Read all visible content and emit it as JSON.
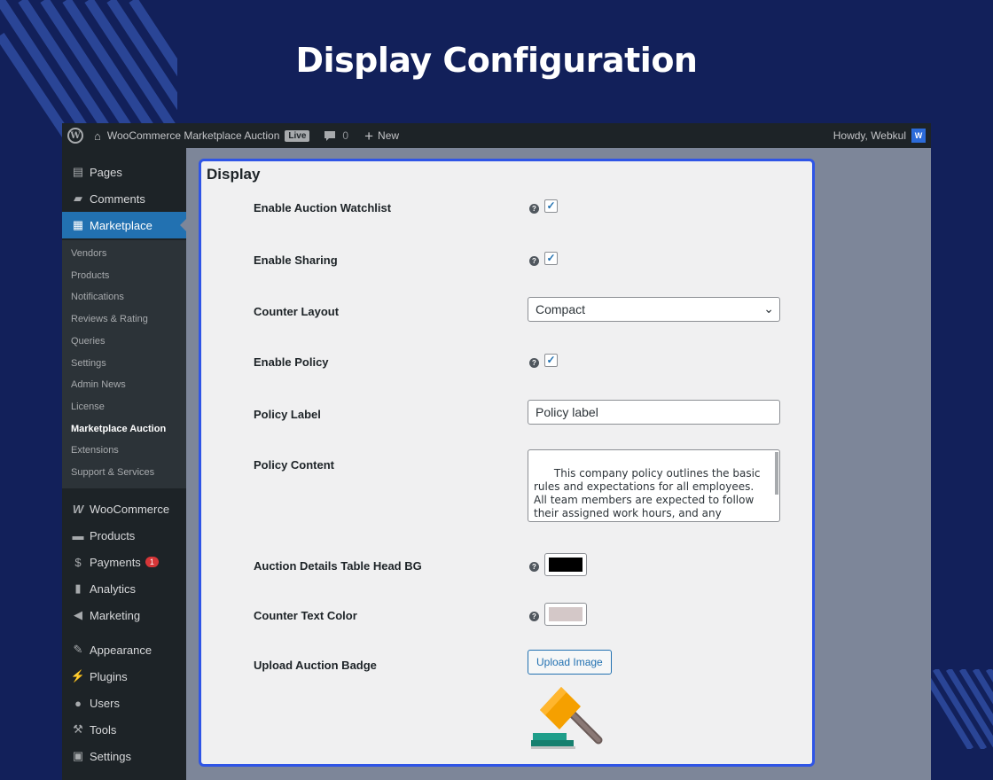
{
  "hero": {
    "title": "Display Configuration"
  },
  "colors": {
    "background": "#12205a",
    "accent": "#2f55e6",
    "wp_blue": "#2271b1",
    "admin_bar": "#1d2327",
    "table_head_bg": "#000000",
    "counter_text": "#d4c8c8"
  },
  "adminbar": {
    "wp_icon": "wordpress-icon",
    "site_icon": "home-icon",
    "site_name": "WooCommerce Marketplace Auction",
    "live_badge": "Live",
    "comments_icon": "comment-bubble-icon",
    "comments_count": "0",
    "new_icon": "plus-icon",
    "new_label": "New",
    "howdy": "Howdy, Webkul"
  },
  "sidebar": {
    "top_items": [
      {
        "label": "Pages",
        "icon": "pages-icon"
      },
      {
        "label": "Comments",
        "icon": "comment-icon"
      },
      {
        "label": "Marketplace",
        "icon": "store-icon"
      }
    ],
    "submenu": [
      "Vendors",
      "Products",
      "Notifications",
      "Reviews & Rating",
      "Queries",
      "Settings",
      "Admin News",
      "License",
      "Marketplace Auction",
      "Extensions",
      "Support & Services"
    ],
    "bottom_items": [
      {
        "label": "WooCommerce",
        "icon": "woo-icon"
      },
      {
        "label": "Products",
        "icon": "archive-icon"
      },
      {
        "label": "Payments",
        "icon": "dollar-icon",
        "badge": "1"
      },
      {
        "label": "Analytics",
        "icon": "chart-bars-icon"
      },
      {
        "label": "Marketing",
        "icon": "megaphone-icon"
      },
      {
        "label": "Appearance",
        "icon": "brush-icon"
      },
      {
        "label": "Plugins",
        "icon": "plug-icon"
      },
      {
        "label": "Users",
        "icon": "user-icon"
      },
      {
        "label": "Tools",
        "icon": "wrench-icon"
      },
      {
        "label": "Settings",
        "icon": "sliders-icon"
      }
    ]
  },
  "panel": {
    "title": "Display",
    "watchlist": {
      "label": "Enable Auction Watchlist",
      "checked": true
    },
    "sharing": {
      "label": "Enable Sharing",
      "checked": true
    },
    "counter_layout": {
      "label": "Counter Layout",
      "value": "Compact"
    },
    "policy": {
      "label": "Enable Policy",
      "checked": true
    },
    "policy_label": {
      "label": "Policy Label",
      "value": "Policy label"
    },
    "policy_content": {
      "label": "Policy Content",
      "value": "This company policy outlines the basic rules and expectations for all employees. All team members are expected to follow their assigned work hours, and any changes to the schedule must be approved by...."
    },
    "table_head_bg": {
      "label": "Auction Details Table Head BG"
    },
    "counter_text_color": {
      "label": "Counter Text Color"
    },
    "upload_badge": {
      "label": "Upload Auction Badge",
      "button": "Upload Image",
      "image_icon": "auction-gavel-icon"
    },
    "check_mark": "✓",
    "help_mark": "?",
    "select_chevron": "⌄"
  }
}
